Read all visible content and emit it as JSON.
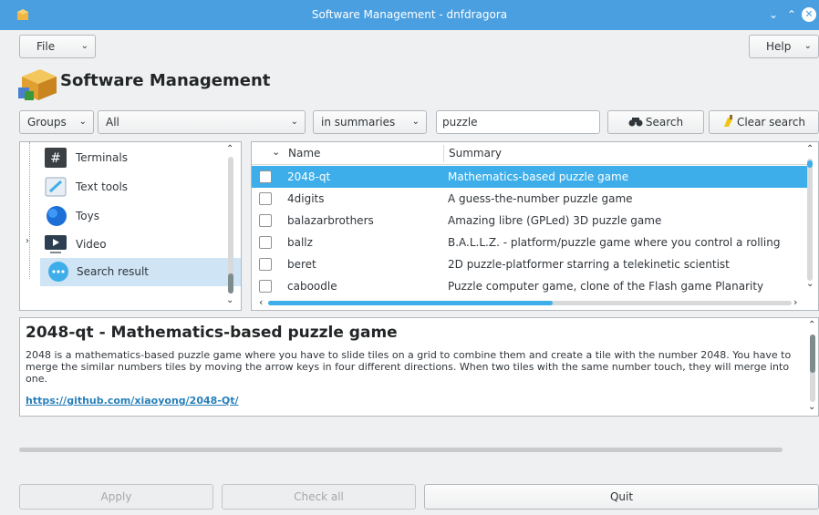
{
  "window": {
    "title": "Software Management - dnfdragora",
    "icons": {
      "app": "package-icon",
      "minimize": "chevron-down-icon",
      "maximize": "chevron-up-icon",
      "close": "close-icon"
    }
  },
  "menubar": {
    "file": "File",
    "help": "Help"
  },
  "header": {
    "title": "Software Management"
  },
  "toolbar": {
    "groups_label": "Groups",
    "filter_value": "All",
    "search_scope": "in summaries",
    "search_value": "puzzle",
    "search_button": "Search",
    "clear_button": "Clear search"
  },
  "tree": {
    "items": [
      {
        "label": "Terminals",
        "icon": "terminal-icon"
      },
      {
        "label": "Text tools",
        "icon": "text-editor-icon"
      },
      {
        "label": "Toys",
        "icon": "toys-icon"
      },
      {
        "label": "Video",
        "icon": "video-icon"
      },
      {
        "label": "Search result",
        "icon": "ellipsis-icon"
      }
    ]
  },
  "table": {
    "columns": {
      "name": "Name",
      "summary": "Summary"
    },
    "rows": [
      {
        "name": "2048-qt",
        "summary": "Mathematics-based puzzle game",
        "selected": true
      },
      {
        "name": "4digits",
        "summary": "A guess-the-number puzzle game"
      },
      {
        "name": "balazarbrothers",
        "summary": "Amazing libre (GPLed) 3D puzzle game"
      },
      {
        "name": "ballz",
        "summary": "B.A.L.L.Z. - platform/puzzle game where you control a rolling"
      },
      {
        "name": "beret",
        "summary": "2D puzzle-platformer starring a telekinetic scientist"
      },
      {
        "name": "caboodle",
        "summary": "Puzzle computer game, clone of the Flash game Planarity"
      }
    ]
  },
  "details": {
    "title": "2048-qt - Mathematics-based puzzle game",
    "description": "2048 is a mathematics-based puzzle game where you have to slide tiles on a grid to combine them and create a tile with the number 2048. You have to merge the similar numbers tiles by moving the arrow keys in four different directions. When two tiles with the same number touch, they will merge into one.",
    "url": "https://github.com/xiaoyong/2048-Qt/"
  },
  "buttons": {
    "apply": "Apply",
    "check_all": "Check all",
    "quit": "Quit"
  },
  "colors": {
    "titlebar": "#4a9fe0",
    "selection": "#3daee9",
    "link": "#2980b9"
  }
}
